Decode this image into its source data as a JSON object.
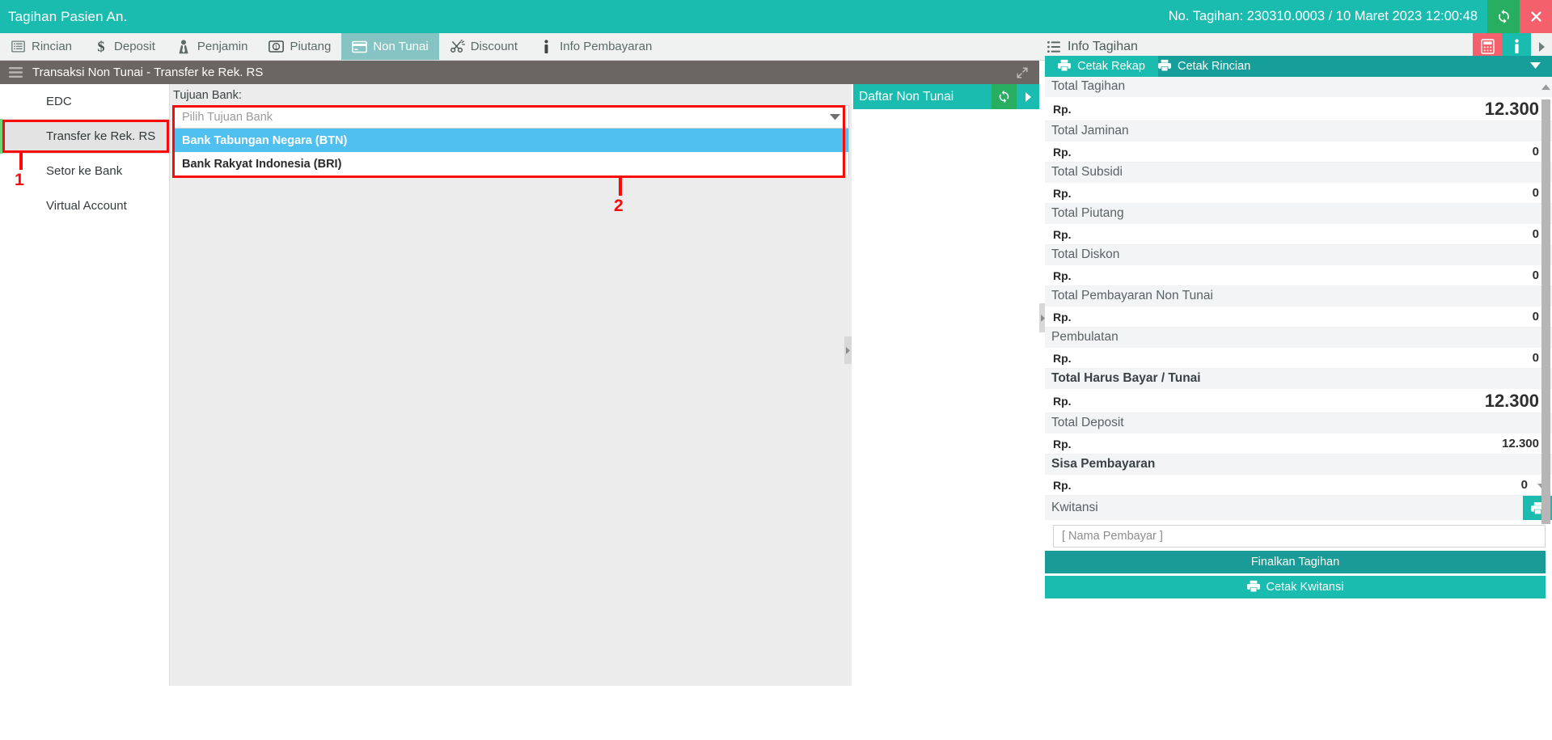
{
  "titlebar": {
    "title": "Tagihan Pasien An.",
    "bill_no": "No. Tagihan: 230310.0003 / 10 Maret 2023 12:00:48",
    "refresh_icon": "refresh-icon",
    "close_icon": "close-icon"
  },
  "tabs": [
    {
      "label": "Rincian",
      "icon": "list-icon",
      "active": false
    },
    {
      "label": "Deposit",
      "icon": "dollar-icon",
      "active": false
    },
    {
      "label": "Penjamin",
      "icon": "tie-icon",
      "active": false
    },
    {
      "label": "Piutang",
      "icon": "coin-icon",
      "active": false
    },
    {
      "label": "Non Tunai",
      "icon": "card-icon",
      "active": true
    },
    {
      "label": "Discount",
      "icon": "scissors-icon",
      "active": false
    },
    {
      "label": "Info Pembayaran",
      "icon": "info-icon",
      "active": false
    }
  ],
  "subheader": {
    "title": "Transaksi Non Tunai - Transfer ke Rek. RS",
    "menu_icon": "hamburger-icon",
    "expand_icon": "expand-icon"
  },
  "subnav": {
    "items": [
      {
        "label": "EDC",
        "selected": false
      },
      {
        "label": "Transfer ke Rek. RS",
        "selected": true
      },
      {
        "label": "Setor ke Bank",
        "selected": false
      },
      {
        "label": "Virtual Account",
        "selected": false
      }
    ]
  },
  "main": {
    "field_label": "Tujuan Bank:",
    "select_placeholder": "Pilih Tujuan Bank",
    "options": [
      {
        "label": "Bank Tabungan Negara (BTN)",
        "highlighted": true
      },
      {
        "label": "Bank Rakyat Indonesia (BRI)",
        "highlighted": false
      }
    ]
  },
  "annotations": [
    {
      "number": "1",
      "target": "subnav-item-transfer-ke-rek-rs"
    },
    {
      "number": "2",
      "target": "bank-dropdown"
    }
  ],
  "daftar": {
    "title": "Daftar Non Tunai",
    "refresh_icon": "refresh-icon",
    "arrow_icon": "chevron-right-icon"
  },
  "info_panel": {
    "title": "Info Tagihan",
    "menu_icon": "list-icon",
    "calc_icon": "calculator-icon",
    "info_icon": "info-icon",
    "arrow_icon": "chevron-right-icon",
    "print_tabs": [
      {
        "label": "Cetak Rekap",
        "icon": "printer-icon",
        "active": true
      },
      {
        "label": "Cetak Rincian",
        "icon": "printer-icon",
        "active": false
      }
    ]
  },
  "finance": {
    "currency": "Rp.",
    "rows": [
      {
        "label": "Total Tagihan",
        "value": "12.300",
        "big": true,
        "bold_label": false
      },
      {
        "label": "Total Jaminan",
        "value": "0",
        "big": false,
        "bold_label": false
      },
      {
        "label": "Total Subsidi",
        "value": "0",
        "big": false,
        "bold_label": false
      },
      {
        "label": "Total Piutang",
        "value": "0",
        "big": false,
        "bold_label": false
      },
      {
        "label": "Total Diskon",
        "value": "0",
        "big": false,
        "bold_label": false
      },
      {
        "label": "Total Pembayaran Non Tunai",
        "value": "0",
        "big": false,
        "bold_label": false
      },
      {
        "label": "Pembulatan",
        "value": "0",
        "big": false,
        "bold_label": false
      },
      {
        "label": "Total Harus Bayar / Tunai",
        "value": "12.300",
        "big": true,
        "bold_label": true
      },
      {
        "label": "Total Deposit",
        "value": "12.300",
        "big": false,
        "bold_label": false
      },
      {
        "label": "Sisa Pembayaran",
        "value": "0",
        "big": false,
        "bold_label": true
      }
    ],
    "kwitansi_label": "Kwitansi",
    "kwitansi_print_icon": "printer-icon",
    "payer_placeholder": "[ Nama Pembayar ]",
    "finalize_label": "Finalkan Tagihan",
    "print_receipt_label": "Cetak Kwitansi",
    "print_receipt_icon": "printer-icon"
  },
  "colors": {
    "brand_teal": "#1abcb0",
    "brand_teal_dark": "#159e9a",
    "green": "#27ae60",
    "red_close": "#f4606c",
    "annotation_red": "#fb0a0a",
    "highlight_blue": "#4fc0f0",
    "subheader_gray": "#6b6663",
    "active_tab": "#85c4c2"
  }
}
